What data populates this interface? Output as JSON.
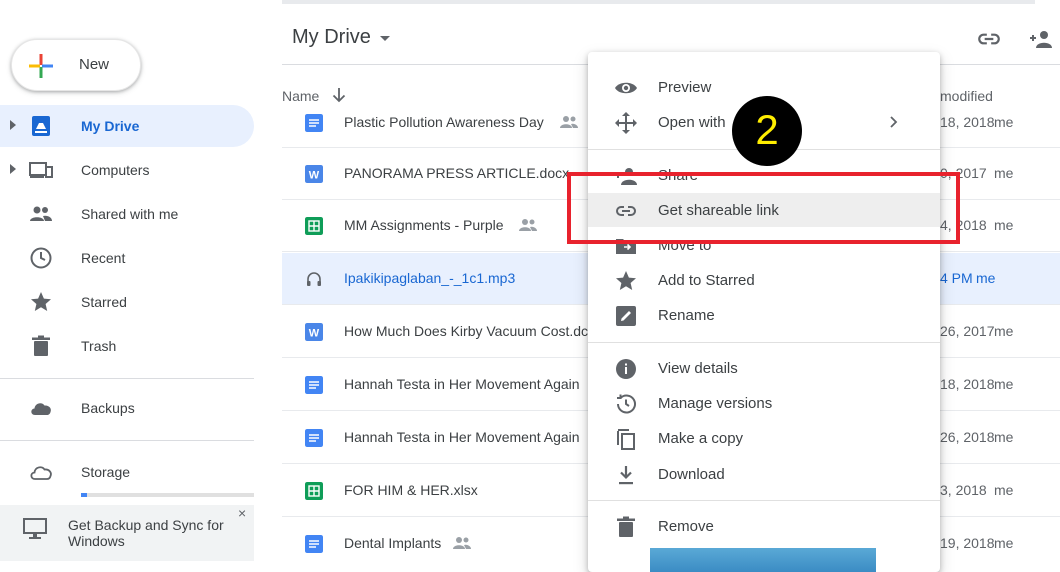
{
  "sidebar": {
    "new_label": "New",
    "items": [
      {
        "label": "My Drive",
        "icon": "drive-icon"
      },
      {
        "label": "Computers",
        "icon": "computer-icon"
      },
      {
        "label": "Shared with me",
        "icon": "people-icon"
      },
      {
        "label": "Recent",
        "icon": "clock-icon"
      },
      {
        "label": "Starred",
        "icon": "star-icon"
      },
      {
        "label": "Trash",
        "icon": "trash-icon"
      },
      {
        "label": "Backups",
        "icon": "cloud-icon"
      },
      {
        "label": "Storage",
        "icon": "cloud-outline-icon"
      }
    ],
    "selected": "My Drive",
    "storage_used_fraction": 0.035,
    "sync_banner": {
      "text": "Get Backup and Sync for Windows",
      "close": "×"
    }
  },
  "header": {
    "title": "My Drive",
    "columns": {
      "name": "Name",
      "modified": "modified"
    }
  },
  "files": [
    {
      "name": "Plastic Pollution Awareness Day",
      "type": "doc",
      "shared": true,
      "modified": "18, 2018",
      "owner": "me"
    },
    {
      "name": "PANORAMA PRESS ARTICLE.docx",
      "type": "word",
      "shared": false,
      "modified": "0, 2017",
      "owner": "me"
    },
    {
      "name": "MM Assignments - Purple",
      "type": "sheet",
      "shared": true,
      "modified": "4, 2018",
      "owner": "me"
    },
    {
      "name": "Ipakikipaglaban_-_1c1.mp3",
      "type": "audio",
      "shared": false,
      "modified": "4 PM",
      "owner": "me",
      "selected": true
    },
    {
      "name": "How Much Does Kirby Vacuum Cost.dc",
      "type": "word",
      "shared": false,
      "modified": "26, 2017",
      "owner": "me"
    },
    {
      "name": "Hannah Testa in Her Movement Again",
      "type": "doc",
      "shared": false,
      "modified": "18, 2018",
      "owner": "me"
    },
    {
      "name": "Hannah Testa in Her Movement Again",
      "type": "doc",
      "shared": false,
      "modified": "26, 2018",
      "owner": "me"
    },
    {
      "name": "FOR HIM & HER.xlsx",
      "type": "sheet",
      "shared": false,
      "modified": "3, 2018",
      "owner": "me"
    },
    {
      "name": "Dental Implants",
      "type": "doc",
      "shared": true,
      "modified": "19, 2018",
      "owner": "me"
    }
  ],
  "context_menu": {
    "items": [
      {
        "label": "Preview",
        "icon": "eye-icon"
      },
      {
        "label": "Open with",
        "icon": "move-arrows-icon",
        "submenu": true
      },
      {
        "label": "Share",
        "icon": "add-person-icon"
      },
      {
        "label": "Get shareable link",
        "icon": "link-icon",
        "highlighted": true
      },
      {
        "label": "Move to",
        "icon": "folder-move-icon"
      },
      {
        "label": "Add to Starred",
        "icon": "star-icon"
      },
      {
        "label": "Rename",
        "icon": "pencil-icon"
      },
      {
        "label": "View details",
        "icon": "info-icon"
      },
      {
        "label": "Manage versions",
        "icon": "history-icon"
      },
      {
        "label": "Make a copy",
        "icon": "copy-icon"
      },
      {
        "label": "Download",
        "icon": "download-icon"
      },
      {
        "label": "Remove",
        "icon": "trash-icon"
      }
    ]
  },
  "annotation": {
    "step_number": "2"
  },
  "colors": {
    "accent": "#1967d2",
    "selected_bg": "#e8f0fe",
    "annotation_red": "#e8222d",
    "annotation_yellow": "#ffee00"
  }
}
